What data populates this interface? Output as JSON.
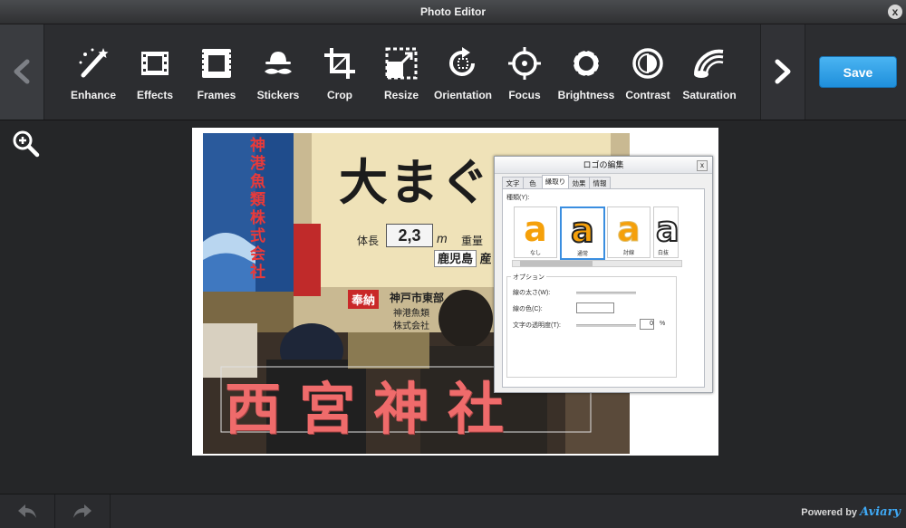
{
  "window": {
    "title": "Photo Editor",
    "close_label": "x"
  },
  "toolbar": {
    "tools": [
      {
        "label": "Enhance",
        "icon": "magic-wand-icon"
      },
      {
        "label": "Effects",
        "icon": "film-icon"
      },
      {
        "label": "Frames",
        "icon": "frame-icon"
      },
      {
        "label": "Stickers",
        "icon": "mustache-hat-icon"
      },
      {
        "label": "Crop",
        "icon": "crop-icon"
      },
      {
        "label": "Resize",
        "icon": "resize-icon"
      },
      {
        "label": "Orientation",
        "icon": "rotate-icon"
      },
      {
        "label": "Focus",
        "icon": "target-icon"
      },
      {
        "label": "Brightness",
        "icon": "sun-icon"
      },
      {
        "label": "Contrast",
        "icon": "contrast-icon"
      },
      {
        "label": "Saturation",
        "icon": "rainbow-icon"
      }
    ],
    "save_label": "Save"
  },
  "footer": {
    "powered_label": "Powered by",
    "brand": "Aviary"
  },
  "photo": {
    "sign_top": "大まぐろ",
    "size_label": "体長",
    "size_value": "2,3",
    "size_unit": "m",
    "weight_label": "重量",
    "origin": "鹿児島",
    "origin_suffix": "産",
    "dedication": "奉納",
    "donor_line1": "神戸市東部",
    "donor_line2": "神港魚類",
    "donor_line3": "株式会社",
    "banner_text": "神港魚類株式会社",
    "overlay_text": "西宮神社"
  },
  "dialog": {
    "title": "ロゴの編集",
    "tabs": [
      "文字",
      "色",
      "縁取り",
      "効果",
      "情報"
    ],
    "kind_label": "種類(Y):",
    "styles": [
      {
        "glyph": "a",
        "caption": "なし"
      },
      {
        "glyph": "a",
        "caption": "通常"
      },
      {
        "glyph": "a",
        "caption": "討線"
      },
      {
        "glyph": "a",
        "caption": "白抜"
      }
    ],
    "options_label": "オプション",
    "line_width_label": "線の太さ(W):",
    "line_color_label": "線の色(C):",
    "transparency_label": "文字の透明度(T):",
    "transparency_value": "0",
    "percent": "%"
  }
}
